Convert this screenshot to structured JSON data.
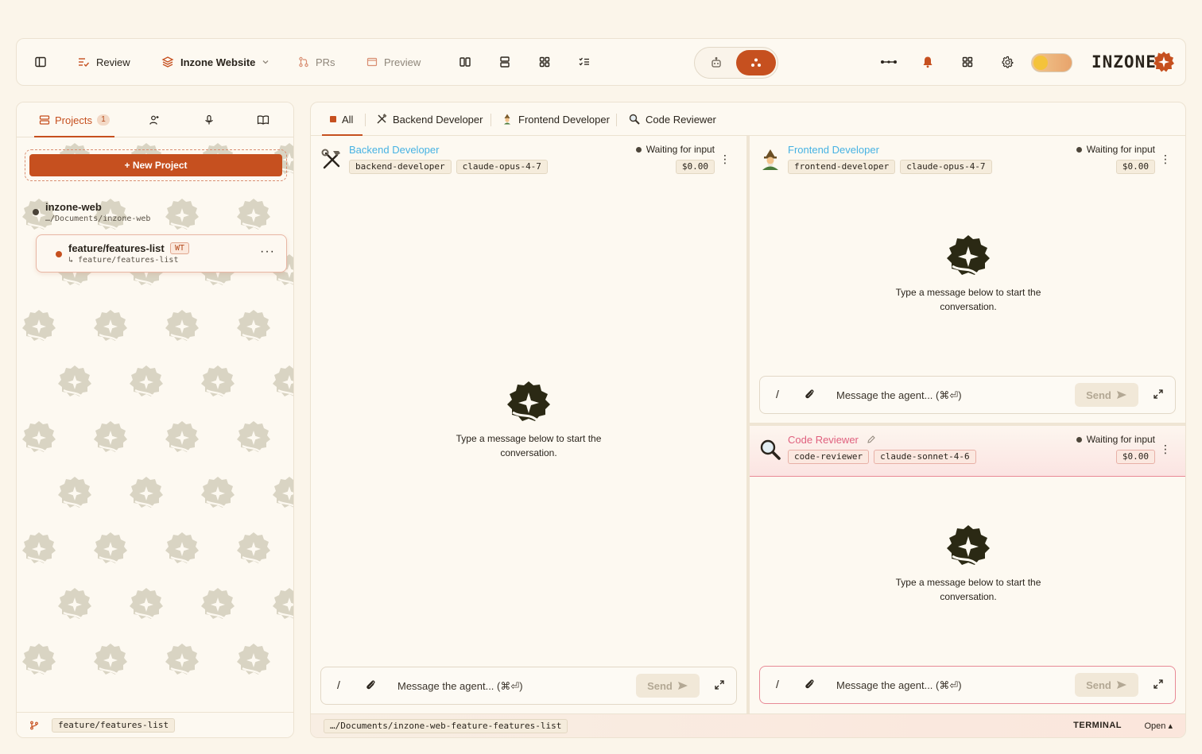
{
  "topbar": {
    "review_label": "Review",
    "project_label": "Inzone Website",
    "prs_label": "PRs",
    "preview_label": "Preview",
    "logo_text": "INZONE"
  },
  "sidebar": {
    "tabs": {
      "projects_label": "Projects",
      "projects_count": "1"
    },
    "new_project_label": "+ New Project",
    "project": {
      "name": "inzone-web",
      "path": "…/Documents/inzone-web"
    },
    "worktree": {
      "name": "feature/features-list",
      "badge": "WT",
      "branch": "↳ feature/features-list",
      "more": "···"
    },
    "footer_branch": "feature/features-list"
  },
  "main": {
    "tabs": [
      {
        "label": "All"
      },
      {
        "label": "Backend Developer"
      },
      {
        "label": "Frontend Developer"
      },
      {
        "label": "Code Reviewer"
      }
    ],
    "agents": [
      {
        "title": "Backend Developer",
        "tags": [
          "backend-developer",
          "claude-opus-4-7"
        ],
        "status": "Waiting for input",
        "cost": "$0.00",
        "icon": "hammer-wrench-icon"
      },
      {
        "title": "Frontend Developer",
        "tags": [
          "frontend-developer",
          "claude-opus-4-7"
        ],
        "status": "Waiting for input",
        "cost": "$0.00",
        "icon": "mage-icon"
      },
      {
        "title": "Code Reviewer",
        "tags": [
          "code-reviewer",
          "claude-sonnet-4-6"
        ],
        "status": "Waiting for input",
        "cost": "$0.00",
        "icon": "magnifier-icon"
      }
    ],
    "empty_line1": "Type a message below to start the",
    "empty_line2": "conversation.",
    "composer": {
      "slash": "/",
      "placeholder": "Message the agent... (⌘⏎)",
      "send_label": "Send"
    },
    "footer": {
      "path": "…/Documents/inzone-web-feature-features-list",
      "terminal_label": "TERMINAL",
      "open_label": "Open ▴"
    }
  },
  "colors": {
    "accent": "#c6501f",
    "background": "#fbf5ea",
    "agent_title_blue": "#46b2e3",
    "agent_title_pink": "#e0607e"
  }
}
